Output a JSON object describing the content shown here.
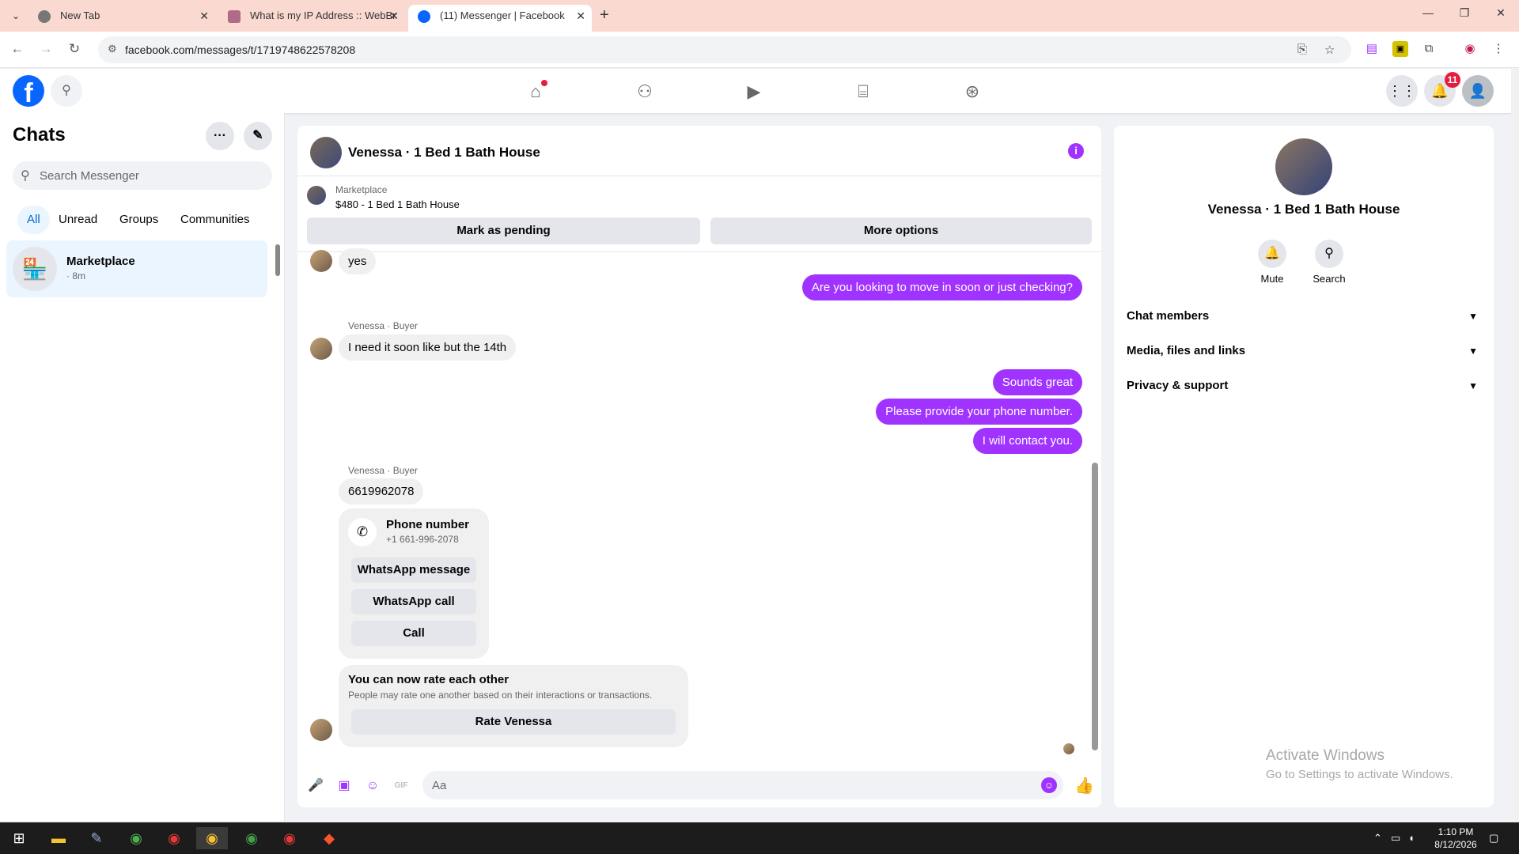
{
  "browser": {
    "tabs": [
      {
        "title": "New Tab"
      },
      {
        "title": "What is my IP Address :: WebBr"
      },
      {
        "title": "(11) Messenger | Facebook"
      }
    ],
    "url": "facebook.com/messages/t/1719748622578208"
  },
  "header": {
    "notifications_badge": "11"
  },
  "sidebar": {
    "title": "Chats",
    "search_placeholder": "Search Messenger",
    "filters": [
      "All",
      "Unread",
      "Groups",
      "Communities"
    ],
    "active_filter": "All",
    "conversations": [
      {
        "name": "Marketplace",
        "meta": "· 8m"
      }
    ]
  },
  "chat": {
    "title": "Venessa · 1 Bed 1 Bath House",
    "marketplace_label": "Marketplace",
    "listing": "$480 - 1 Bed 1 Bath House",
    "mark_pending": "Mark as pending",
    "more_options": "More options",
    "messages": {
      "m1": "yes",
      "m2": "Are you looking to move in soon or just checking?",
      "sender": "Venessa · Buyer",
      "m3": "I need it soon like but the 14th",
      "m4": "Sounds great",
      "m5": "Please provide your phone number.",
      "m6": "I will contact you.",
      "m7": "6619962078"
    },
    "phone_card": {
      "title": "Phone number",
      "number": "+1 661-996-2078",
      "btn_whatsapp_msg": "WhatsApp message",
      "btn_whatsapp_call": "WhatsApp call",
      "btn_call": "Call"
    },
    "rate_card": {
      "title": "You can now rate each other",
      "subtitle": "People may rate one another based on their interactions or transactions.",
      "button": "Rate Venessa"
    },
    "composer_placeholder": "Aa"
  },
  "details": {
    "name": "Venessa · 1 Bed 1 Bath House",
    "actions": [
      "Mute",
      "Search"
    ],
    "sections": [
      "Chat members",
      "Media, files and links",
      "Privacy & support"
    ]
  },
  "watermark": {
    "line1": "Activate Windows",
    "line2": "Go to Settings to activate Windows."
  },
  "taskbar": {
    "time": "1:10 PM",
    "date": "8/12/2026"
  },
  "colors": {
    "accent": "#a033ff",
    "fb_blue": "#0866ff",
    "tab_bar": "#f9d9d0"
  }
}
